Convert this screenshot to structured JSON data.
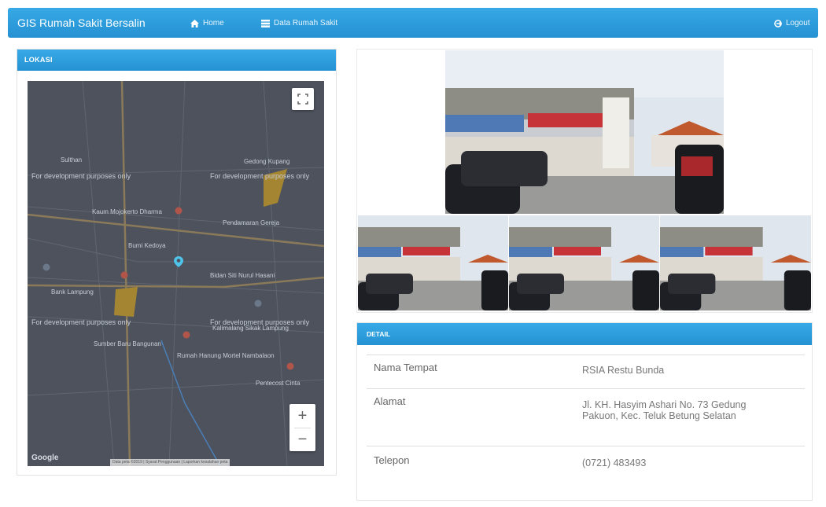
{
  "navbar": {
    "brand": "GIS Rumah Sakit Bersalin",
    "home_label": "Home",
    "data_label": "Data Rumah Sakit",
    "logout_label": "Logout",
    "home_icon": "home-icon",
    "data_icon": "list-icon",
    "logout_icon": "logout-icon",
    "color": "#2c9fdd"
  },
  "location_panel": {
    "title": "LOKASI",
    "map": {
      "dev_watermark": "For development purposes only",
      "labels": [
        "Sulthan",
        "Gedong Kupang",
        "Kaum Mojokerto Dharma",
        "Pendamaran Gereja",
        "Bumi Kedoya",
        "Bidan Siti Nurul Hasani",
        "Bank Lampung",
        "Rumah Hanung Mortel Nambalaon",
        "Pentecost Cinta",
        "Sumber Baru Bangunan",
        "Kalimalang Sikak Lampung"
      ],
      "attribution": "Data peta ©2019 | Syarat Penggunaan | Laporkan kesalahan peta",
      "google_logo": "Google",
      "zoom_in": "+",
      "zoom_out": "−",
      "fullscreen_icon": "fullscreen-icon",
      "marker_icon": "location-marker-icon"
    }
  },
  "photos": {
    "main_alt": "RSIA Restu Bunda building",
    "thumb_count": 3
  },
  "detail_panel": {
    "title": "DETAIL",
    "rows": [
      {
        "label": "Nama Tempat",
        "value": "RSIA Restu Bunda"
      },
      {
        "label": "Alamat",
        "value": "Jl. KH. Hasyim Ashari No. 73 Gedung Pakuon, Kec. Teluk Betung Selatan"
      },
      {
        "label": "Telepon",
        "value": "(0721) 483493"
      }
    ]
  }
}
